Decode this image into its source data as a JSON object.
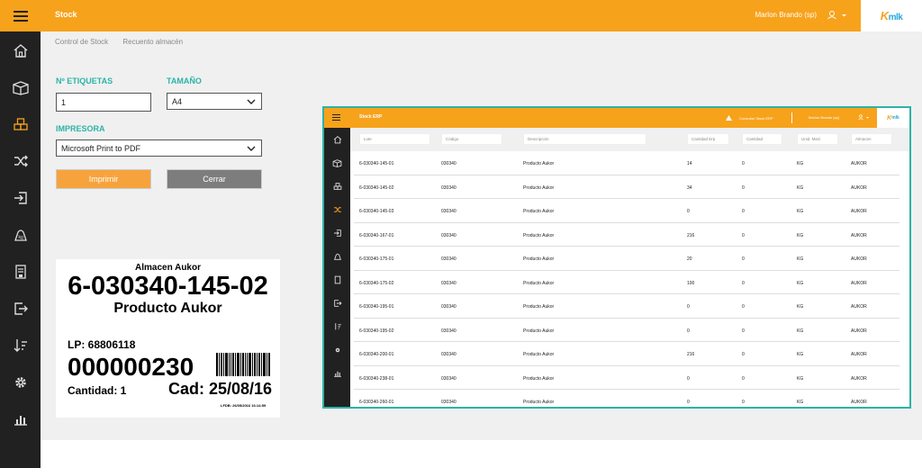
{
  "app": {
    "title": "Stock",
    "user": "Marlon Brando (sp)",
    "logo_main": "K",
    "logo_accent": "mlk"
  },
  "breadcrumb": [
    "Control de Stock",
    "Recuento almacén"
  ],
  "form": {
    "etiquetas_label": "Nº ETIQUETAS",
    "etiquetas_value": "1",
    "tamano_label": "TAMAÑO",
    "tamano_value": "A4",
    "impresora_label": "IMPRESORA",
    "impresora_value": "Microsoft Print to PDF",
    "print_button": "Imprimir",
    "close_button": "Cerrar"
  },
  "label_preview": {
    "warehouse": "Almacen Aukor",
    "lot": "6-030340-145-02",
    "product": "Producto Aukor",
    "lp": "LP: 68806118",
    "code": "000000230",
    "quantity": "Cantidad: 1",
    "expiry": "Cad: 25/08/16",
    "footer": "LFDB: 26/05/2016 16:14:59"
  },
  "inner_app": {
    "title": "Stock ERP",
    "consult": "Consultar Stock ERP",
    "user": "Marlon Brando (sp)",
    "logo_main": "K",
    "logo_accent": "mlk",
    "filters": [
      "Lote",
      "Código",
      "Descripción",
      "Cantidad Erp",
      "Cantidad",
      "Unid. Med.",
      "Almacen"
    ],
    "rows": [
      [
        "6-030340-145-01",
        "030340",
        "Producto Aukor",
        "14",
        "0",
        "KG",
        "AUKOR"
      ],
      [
        "6-030340-145-02",
        "030340",
        "Producto Aukor",
        "34",
        "0",
        "KG",
        "AUKOR"
      ],
      [
        "6-030340-145-03",
        "030340",
        "Producto Aukor",
        "0",
        "0",
        "KG",
        "AUKOR"
      ],
      [
        "6-030340-167-01",
        "030340",
        "Producto Aukor",
        "216",
        "0",
        "KG",
        "AUKOR"
      ],
      [
        "6-030340-175-01",
        "030340",
        "Producto Aukor",
        "20",
        "0",
        "KG",
        "AUKOR"
      ],
      [
        "6-030340-175-02",
        "030340",
        "Producto Aukor",
        "100",
        "0",
        "KG",
        "AUKOR"
      ],
      [
        "6-030340-195-01",
        "030340",
        "Producto Aukor",
        "0",
        "0",
        "KG",
        "AUKOR"
      ],
      [
        "6-030340-195-02",
        "030340",
        "Producto Aukor",
        "0",
        "0",
        "KG",
        "AUKOR"
      ],
      [
        "6-030340-200-01",
        "030340",
        "Producto Aukor",
        "216",
        "0",
        "KG",
        "AUKOR"
      ],
      [
        "6-030340-238-01",
        "030340",
        "Producto Aukor",
        "0",
        "0",
        "KG",
        "AUKOR"
      ],
      [
        "6-030340-260-01",
        "030340",
        "Producto Aukor",
        "0",
        "0",
        "KG",
        "AUKOR"
      ]
    ]
  },
  "sidebar_icons": [
    "home-icon",
    "box-icon",
    "boxes-icon",
    "shuffle-icon",
    "login-icon",
    "weight-bag-icon",
    "scale-icon",
    "logout-icon",
    "sort-desc-icon",
    "gear-icon",
    "bar-chart-icon"
  ],
  "colors": {
    "accent": "#f7a21b",
    "teal": "#2bb4a6",
    "sidebar": "#212121",
    "print_button": "#f7a33d",
    "close_button": "#7d7d7d"
  }
}
